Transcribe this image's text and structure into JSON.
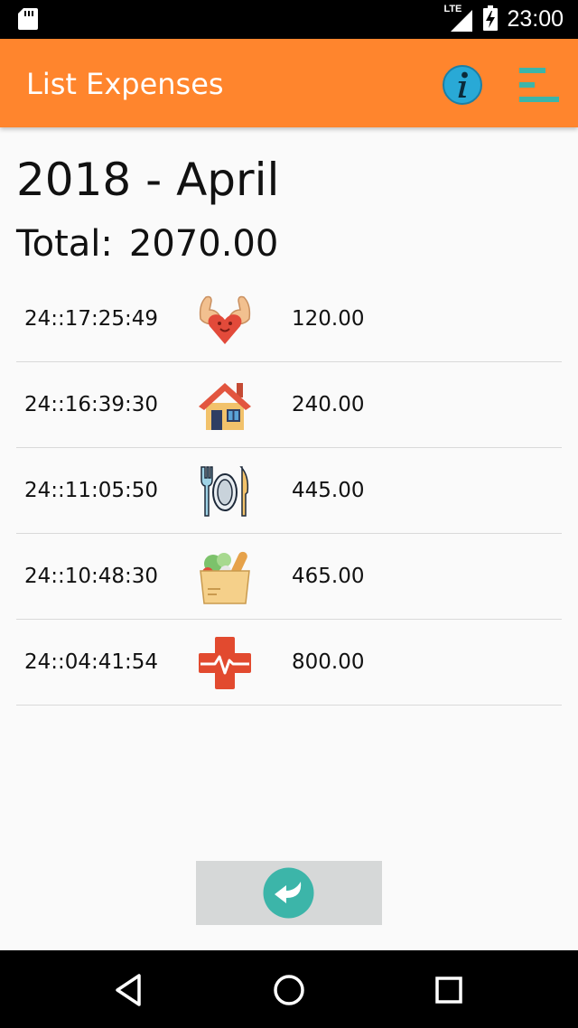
{
  "status_bar": {
    "time": "23:00",
    "network": "LTE"
  },
  "app_bar": {
    "title": "List Expenses"
  },
  "summary": {
    "month": "2018 - April",
    "total_label": "Total:",
    "total_value": "2070.00"
  },
  "expenses": [
    {
      "time": "24::17:25:49",
      "icon": "fitness-heart-icon",
      "amount": "120.00"
    },
    {
      "time": "24::16:39:30",
      "icon": "house-icon",
      "amount": "240.00"
    },
    {
      "time": "24::11:05:50",
      "icon": "plate-cutlery-icon",
      "amount": "445.00"
    },
    {
      "time": "24::10:48:30",
      "icon": "grocery-bag-icon",
      "amount": "465.00"
    },
    {
      "time": "24::04:41:54",
      "icon": "medical-cross-icon",
      "amount": "800.00"
    }
  ],
  "colors": {
    "accent": "#ff852d",
    "teal": "#3cb5a9",
    "info": "#29a9d6"
  }
}
